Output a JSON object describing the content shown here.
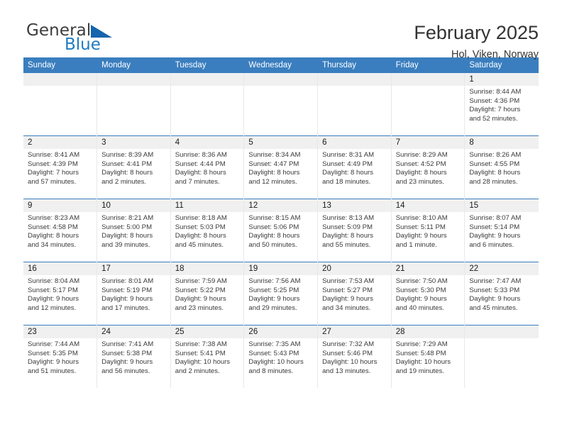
{
  "brand": {
    "name_part1": "General",
    "name_part2": "Blue",
    "triangle_color": "#1566ad",
    "blue_color": "#1f7bc1"
  },
  "header": {
    "title": "February 2025",
    "subtitle": "Hol, Viken, Norway"
  },
  "theme": {
    "header_row_bg": "#3a7ebf",
    "daynum_strip_bg": "#f0f0f0",
    "cell_bg": "#ffffff",
    "divider": "#3a7ebf"
  },
  "weekday_headers": [
    "Sunday",
    "Monday",
    "Tuesday",
    "Wednesday",
    "Thursday",
    "Friday",
    "Saturday"
  ],
  "labels": {
    "sunrise_prefix": "Sunrise:",
    "sunset_prefix": "Sunset:",
    "daylight_prefix": "Daylight:"
  },
  "weeks": [
    [
      {
        "day": "",
        "sunrise": "",
        "sunset": "",
        "daylight_line1": "",
        "daylight_line2": ""
      },
      {
        "day": "",
        "sunrise": "",
        "sunset": "",
        "daylight_line1": "",
        "daylight_line2": ""
      },
      {
        "day": "",
        "sunrise": "",
        "sunset": "",
        "daylight_line1": "",
        "daylight_line2": ""
      },
      {
        "day": "",
        "sunrise": "",
        "sunset": "",
        "daylight_line1": "",
        "daylight_line2": ""
      },
      {
        "day": "",
        "sunrise": "",
        "sunset": "",
        "daylight_line1": "",
        "daylight_line2": ""
      },
      {
        "day": "",
        "sunrise": "",
        "sunset": "",
        "daylight_line1": "",
        "daylight_line2": ""
      },
      {
        "day": "1",
        "sunrise": "Sunrise: 8:44 AM",
        "sunset": "Sunset: 4:36 PM",
        "daylight_line1": "Daylight: 7 hours",
        "daylight_line2": "and 52 minutes."
      }
    ],
    [
      {
        "day": "2",
        "sunrise": "Sunrise: 8:41 AM",
        "sunset": "Sunset: 4:39 PM",
        "daylight_line1": "Daylight: 7 hours",
        "daylight_line2": "and 57 minutes."
      },
      {
        "day": "3",
        "sunrise": "Sunrise: 8:39 AM",
        "sunset": "Sunset: 4:41 PM",
        "daylight_line1": "Daylight: 8 hours",
        "daylight_line2": "and 2 minutes."
      },
      {
        "day": "4",
        "sunrise": "Sunrise: 8:36 AM",
        "sunset": "Sunset: 4:44 PM",
        "daylight_line1": "Daylight: 8 hours",
        "daylight_line2": "and 7 minutes."
      },
      {
        "day": "5",
        "sunrise": "Sunrise: 8:34 AM",
        "sunset": "Sunset: 4:47 PM",
        "daylight_line1": "Daylight: 8 hours",
        "daylight_line2": "and 12 minutes."
      },
      {
        "day": "6",
        "sunrise": "Sunrise: 8:31 AM",
        "sunset": "Sunset: 4:49 PM",
        "daylight_line1": "Daylight: 8 hours",
        "daylight_line2": "and 18 minutes."
      },
      {
        "day": "7",
        "sunrise": "Sunrise: 8:29 AM",
        "sunset": "Sunset: 4:52 PM",
        "daylight_line1": "Daylight: 8 hours",
        "daylight_line2": "and 23 minutes."
      },
      {
        "day": "8",
        "sunrise": "Sunrise: 8:26 AM",
        "sunset": "Sunset: 4:55 PM",
        "daylight_line1": "Daylight: 8 hours",
        "daylight_line2": "and 28 minutes."
      }
    ],
    [
      {
        "day": "9",
        "sunrise": "Sunrise: 8:23 AM",
        "sunset": "Sunset: 4:58 PM",
        "daylight_line1": "Daylight: 8 hours",
        "daylight_line2": "and 34 minutes."
      },
      {
        "day": "10",
        "sunrise": "Sunrise: 8:21 AM",
        "sunset": "Sunset: 5:00 PM",
        "daylight_line1": "Daylight: 8 hours",
        "daylight_line2": "and 39 minutes."
      },
      {
        "day": "11",
        "sunrise": "Sunrise: 8:18 AM",
        "sunset": "Sunset: 5:03 PM",
        "daylight_line1": "Daylight: 8 hours",
        "daylight_line2": "and 45 minutes."
      },
      {
        "day": "12",
        "sunrise": "Sunrise: 8:15 AM",
        "sunset": "Sunset: 5:06 PM",
        "daylight_line1": "Daylight: 8 hours",
        "daylight_line2": "and 50 minutes."
      },
      {
        "day": "13",
        "sunrise": "Sunrise: 8:13 AM",
        "sunset": "Sunset: 5:09 PM",
        "daylight_line1": "Daylight: 8 hours",
        "daylight_line2": "and 55 minutes."
      },
      {
        "day": "14",
        "sunrise": "Sunrise: 8:10 AM",
        "sunset": "Sunset: 5:11 PM",
        "daylight_line1": "Daylight: 9 hours",
        "daylight_line2": "and 1 minute."
      },
      {
        "day": "15",
        "sunrise": "Sunrise: 8:07 AM",
        "sunset": "Sunset: 5:14 PM",
        "daylight_line1": "Daylight: 9 hours",
        "daylight_line2": "and 6 minutes."
      }
    ],
    [
      {
        "day": "16",
        "sunrise": "Sunrise: 8:04 AM",
        "sunset": "Sunset: 5:17 PM",
        "daylight_line1": "Daylight: 9 hours",
        "daylight_line2": "and 12 minutes."
      },
      {
        "day": "17",
        "sunrise": "Sunrise: 8:01 AM",
        "sunset": "Sunset: 5:19 PM",
        "daylight_line1": "Daylight: 9 hours",
        "daylight_line2": "and 17 minutes."
      },
      {
        "day": "18",
        "sunrise": "Sunrise: 7:59 AM",
        "sunset": "Sunset: 5:22 PM",
        "daylight_line1": "Daylight: 9 hours",
        "daylight_line2": "and 23 minutes."
      },
      {
        "day": "19",
        "sunrise": "Sunrise: 7:56 AM",
        "sunset": "Sunset: 5:25 PM",
        "daylight_line1": "Daylight: 9 hours",
        "daylight_line2": "and 29 minutes."
      },
      {
        "day": "20",
        "sunrise": "Sunrise: 7:53 AM",
        "sunset": "Sunset: 5:27 PM",
        "daylight_line1": "Daylight: 9 hours",
        "daylight_line2": "and 34 minutes."
      },
      {
        "day": "21",
        "sunrise": "Sunrise: 7:50 AM",
        "sunset": "Sunset: 5:30 PM",
        "daylight_line1": "Daylight: 9 hours",
        "daylight_line2": "and 40 minutes."
      },
      {
        "day": "22",
        "sunrise": "Sunrise: 7:47 AM",
        "sunset": "Sunset: 5:33 PM",
        "daylight_line1": "Daylight: 9 hours",
        "daylight_line2": "and 45 minutes."
      }
    ],
    [
      {
        "day": "23",
        "sunrise": "Sunrise: 7:44 AM",
        "sunset": "Sunset: 5:35 PM",
        "daylight_line1": "Daylight: 9 hours",
        "daylight_line2": "and 51 minutes."
      },
      {
        "day": "24",
        "sunrise": "Sunrise: 7:41 AM",
        "sunset": "Sunset: 5:38 PM",
        "daylight_line1": "Daylight: 9 hours",
        "daylight_line2": "and 56 minutes."
      },
      {
        "day": "25",
        "sunrise": "Sunrise: 7:38 AM",
        "sunset": "Sunset: 5:41 PM",
        "daylight_line1": "Daylight: 10 hours",
        "daylight_line2": "and 2 minutes."
      },
      {
        "day": "26",
        "sunrise": "Sunrise: 7:35 AM",
        "sunset": "Sunset: 5:43 PM",
        "daylight_line1": "Daylight: 10 hours",
        "daylight_line2": "and 8 minutes."
      },
      {
        "day": "27",
        "sunrise": "Sunrise: 7:32 AM",
        "sunset": "Sunset: 5:46 PM",
        "daylight_line1": "Daylight: 10 hours",
        "daylight_line2": "and 13 minutes."
      },
      {
        "day": "28",
        "sunrise": "Sunrise: 7:29 AM",
        "sunset": "Sunset: 5:48 PM",
        "daylight_line1": "Daylight: 10 hours",
        "daylight_line2": "and 19 minutes."
      },
      {
        "day": "",
        "sunrise": "",
        "sunset": "",
        "daylight_line1": "",
        "daylight_line2": ""
      }
    ]
  ]
}
